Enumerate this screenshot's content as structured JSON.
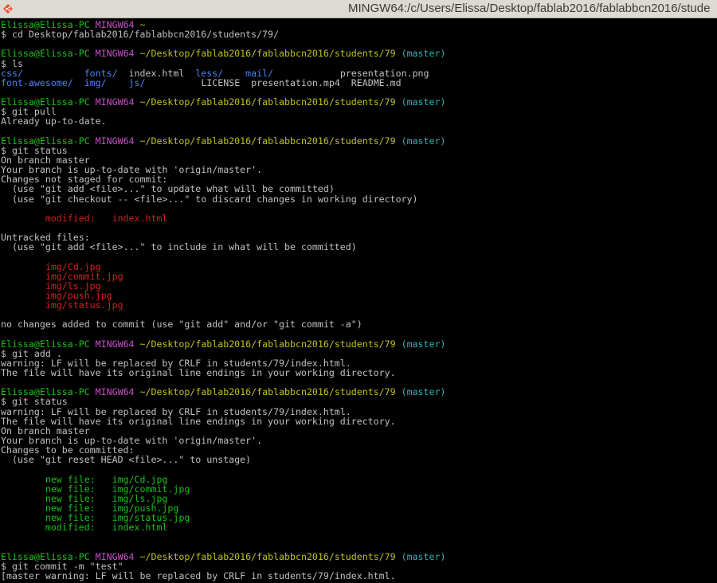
{
  "window": {
    "title": "MINGW64:/c/Users/Elissa/Desktop/fablab2016/fablabbcn2016/stude",
    "icon": "git-bash-icon"
  },
  "colors": {
    "user": "#19c119",
    "msys": "#c94fc9",
    "path": "#c1c11c",
    "branch": "#2bb5b5",
    "dir": "#4d83f5",
    "modified": "#d81f1f",
    "added": "#19c119",
    "text": "#c0c0c0",
    "background": "#000000"
  },
  "terminal": {
    "lines": [
      [
        {
          "t": "Elissa@Elissa-PC",
          "c": "g"
        },
        {
          "t": " ",
          "c": "w"
        },
        {
          "t": "MINGW64",
          "c": "m"
        },
        {
          "t": " ~",
          "c": "y"
        }
      ],
      [
        {
          "t": "$ cd Desktop/fablab2016/fablabbcn2016/students/79/",
          "c": "w"
        }
      ],
      [],
      [
        {
          "t": "Elissa@Elissa-PC",
          "c": "g"
        },
        {
          "t": " ",
          "c": "w"
        },
        {
          "t": "MINGW64",
          "c": "m"
        },
        {
          "t": " ~/Desktop/fablab2016/fablabbcn2016/students/79",
          "c": "y"
        },
        {
          "t": " (master)",
          "c": "c"
        }
      ],
      [
        {
          "t": "$ ls",
          "c": "w"
        }
      ],
      [
        {
          "t": "css/",
          "c": "b"
        },
        {
          "t": "           ",
          "c": "w"
        },
        {
          "t": "fonts/",
          "c": "b"
        },
        {
          "t": "  index.html  ",
          "c": "w"
        },
        {
          "t": "less/",
          "c": "b"
        },
        {
          "t": "    ",
          "c": "w"
        },
        {
          "t": "mail/",
          "c": "b"
        },
        {
          "t": "            presentation.png",
          "c": "w"
        }
      ],
      [
        {
          "t": "font-awesome/",
          "c": "b"
        },
        {
          "t": "  ",
          "c": "w"
        },
        {
          "t": "img/",
          "c": "b"
        },
        {
          "t": "    ",
          "c": "w"
        },
        {
          "t": "js/",
          "c": "b"
        },
        {
          "t": "          LICENSE  presentation.mp4  README.md",
          "c": "w"
        }
      ],
      [],
      [
        {
          "t": "Elissa@Elissa-PC",
          "c": "g"
        },
        {
          "t": " ",
          "c": "w"
        },
        {
          "t": "MINGW64",
          "c": "m"
        },
        {
          "t": " ~/Desktop/fablab2016/fablabbcn2016/students/79",
          "c": "y"
        },
        {
          "t": " (master)",
          "c": "c"
        }
      ],
      [
        {
          "t": "$ git pull",
          "c": "w"
        }
      ],
      [
        {
          "t": "Already up-to-date.",
          "c": "w"
        }
      ],
      [],
      [
        {
          "t": "Elissa@Elissa-PC",
          "c": "g"
        },
        {
          "t": " ",
          "c": "w"
        },
        {
          "t": "MINGW64",
          "c": "m"
        },
        {
          "t": " ~/Desktop/fablab2016/fablabbcn2016/students/79",
          "c": "y"
        },
        {
          "t": " (master)",
          "c": "c"
        }
      ],
      [
        {
          "t": "$ git status",
          "c": "w"
        }
      ],
      [
        {
          "t": "On branch master",
          "c": "w"
        }
      ],
      [
        {
          "t": "Your branch is up-to-date with 'origin/master'.",
          "c": "w"
        }
      ],
      [
        {
          "t": "Changes not staged for commit:",
          "c": "w"
        }
      ],
      [
        {
          "t": "  (use \"git add <file>...\" to update what will be committed)",
          "c": "w"
        }
      ],
      [
        {
          "t": "  (use \"git checkout -- <file>...\" to discard changes in working directory)",
          "c": "w"
        }
      ],
      [],
      [
        {
          "t": "        modified:   index.html",
          "c": "r"
        }
      ],
      [],
      [
        {
          "t": "Untracked files:",
          "c": "w"
        }
      ],
      [
        {
          "t": "  (use \"git add <file>...\" to include in what will be committed)",
          "c": "w"
        }
      ],
      [],
      [
        {
          "t": "        img/Cd.jpg",
          "c": "r"
        }
      ],
      [
        {
          "t": "        img/commit.jpg",
          "c": "r"
        }
      ],
      [
        {
          "t": "        img/ls.jpg",
          "c": "r"
        }
      ],
      [
        {
          "t": "        img/push.jpg",
          "c": "r"
        }
      ],
      [
        {
          "t": "        img/status.jpg",
          "c": "r"
        }
      ],
      [],
      [
        {
          "t": "no changes added to commit (use \"git add\" and/or \"git commit -a\")",
          "c": "w"
        }
      ],
      [],
      [
        {
          "t": "Elissa@Elissa-PC",
          "c": "g"
        },
        {
          "t": " ",
          "c": "w"
        },
        {
          "t": "MINGW64",
          "c": "m"
        },
        {
          "t": " ~/Desktop/fablab2016/fablabbcn2016/students/79",
          "c": "y"
        },
        {
          "t": " (master)",
          "c": "c"
        }
      ],
      [
        {
          "t": "$ git add .",
          "c": "w"
        }
      ],
      [
        {
          "t": "warning: LF will be replaced by CRLF in students/79/index.html.",
          "c": "w"
        }
      ],
      [
        {
          "t": "The file will have its original line endings in your working directory.",
          "c": "w"
        }
      ],
      [],
      [
        {
          "t": "Elissa@Elissa-PC",
          "c": "g"
        },
        {
          "t": " ",
          "c": "w"
        },
        {
          "t": "MINGW64",
          "c": "m"
        },
        {
          "t": " ~/Desktop/fablab2016/fablabbcn2016/students/79",
          "c": "y"
        },
        {
          "t": " (master)",
          "c": "c"
        }
      ],
      [
        {
          "t": "$ git status",
          "c": "w"
        }
      ],
      [
        {
          "t": "warning: LF will be replaced by CRLF in students/79/index.html.",
          "c": "w"
        }
      ],
      [
        {
          "t": "The file will have its original line endings in your working directory.",
          "c": "w"
        }
      ],
      [
        {
          "t": "On branch master",
          "c": "w"
        }
      ],
      [
        {
          "t": "Your branch is up-to-date with 'origin/master'.",
          "c": "w"
        }
      ],
      [
        {
          "t": "Changes to be committed:",
          "c": "w"
        }
      ],
      [
        {
          "t": "  (use \"git reset HEAD <file>...\" to unstage)",
          "c": "w"
        }
      ],
      [],
      [
        {
          "t": "        new file:   img/Cd.jpg",
          "c": "g"
        }
      ],
      [
        {
          "t": "        new file:   img/commit.jpg",
          "c": "g"
        }
      ],
      [
        {
          "t": "        new file:   img/ls.jpg",
          "c": "g"
        }
      ],
      [
        {
          "t": "        new file:   img/push.jpg",
          "c": "g"
        }
      ],
      [
        {
          "t": "        new file:   img/status.jpg",
          "c": "g"
        }
      ],
      [
        {
          "t": "        modified:   index.html",
          "c": "g"
        }
      ],
      [],
      [],
      [
        {
          "t": "Elissa@Elissa-PC",
          "c": "g"
        },
        {
          "t": " ",
          "c": "w"
        },
        {
          "t": "MINGW64",
          "c": "m"
        },
        {
          "t": " ~/Desktop/fablab2016/fablabbcn2016/students/79",
          "c": "y"
        },
        {
          "t": " (master)",
          "c": "c"
        }
      ],
      [
        {
          "t": "$ git commit -m \"test\"",
          "c": "w"
        }
      ],
      [
        {
          "t": "[master warning: LF will be replaced by CRLF in students/79/index.html.",
          "c": "w"
        }
      ]
    ]
  }
}
